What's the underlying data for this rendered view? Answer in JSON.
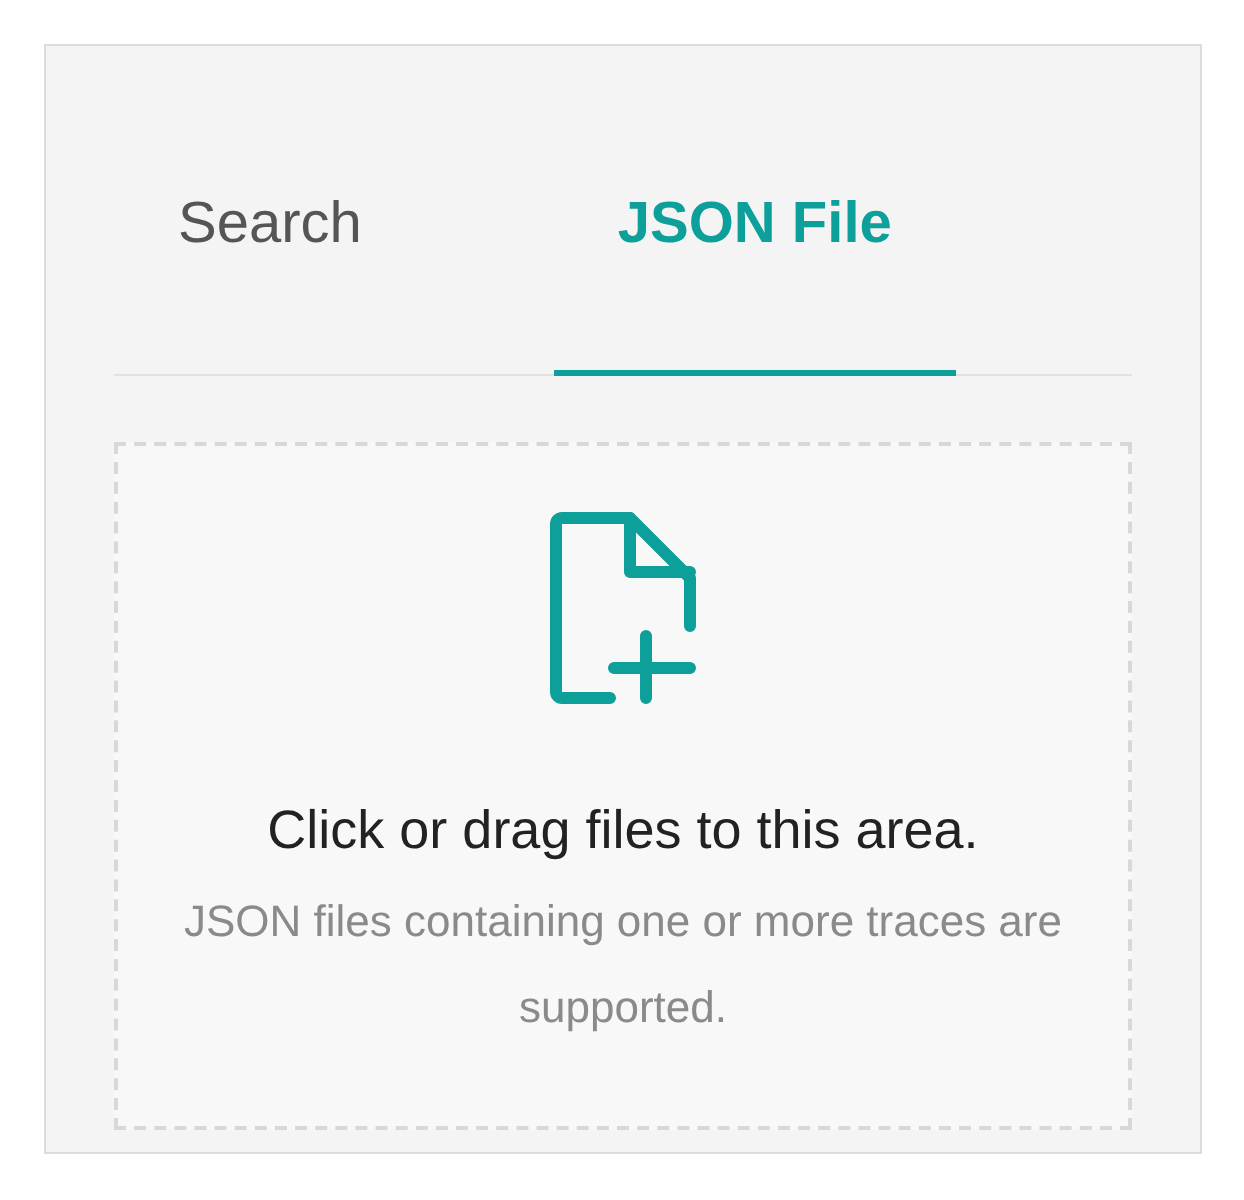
{
  "tabs": [
    {
      "label": "Search",
      "selected": false
    },
    {
      "label": "JSON File",
      "selected": true
    }
  ],
  "dropzone": {
    "title": "Click or drag files to this area.",
    "hint": "JSON files containing one or more traces are supported."
  }
}
